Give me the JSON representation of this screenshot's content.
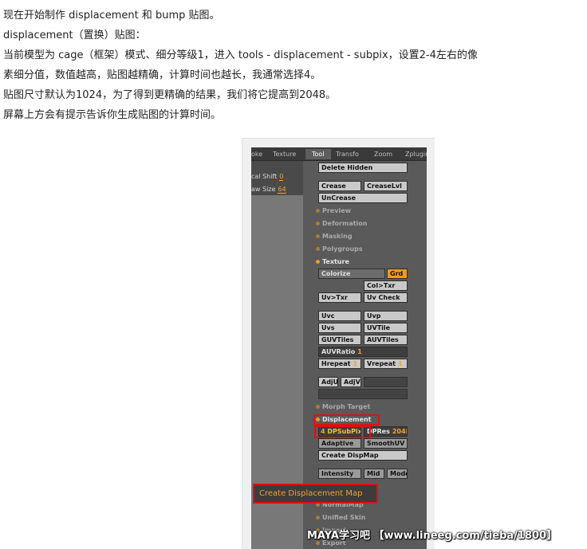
{
  "article": {
    "lines": [
      "现在开始制作 displacement 和 bump 贴图。",
      "displacement（置换）贴图：",
      "当前模型为 cage（框架）模式、细分等级1，进入 tools - displacement - subpix，设置2-4左右的像",
      "素细分值，数值越高，贴图越精确，计算时间也越长，我通常选择4。",
      "贴图尺寸默认为1024，为了得到更精确的结果，我们将它提高到2048。",
      "屏幕上方会有提示告诉你生成贴图的计算时间。"
    ]
  },
  "screenshot": {
    "menu_tabs": [
      "oke",
      "Texture",
      "Tool",
      "Transfo",
      "Zoom",
      "Zplugin"
    ],
    "left_fields": [
      {
        "label": "cal Shift",
        "value": "0"
      },
      {
        "label": "aw Size",
        "value": "64"
      }
    ],
    "buttons": {
      "delete_hidden": "Delete Hidden",
      "crease": "Crease",
      "creaselvl": "CreaseLvl",
      "uncrease": "UnCrease",
      "colorize": "Colorize",
      "grd": "Grd",
      "col_txr": "Col>Txr",
      "uv_txr": "Uv>Txr",
      "uv_check": "Uv Check",
      "uvc": "Uvc",
      "uvp": "Uvp",
      "uvs": "Uvs",
      "uvtile": "UVTile",
      "guvtiles": "GUVTiles",
      "auvtiles": "AUVTiles",
      "auvratio_label": "AUVRatio",
      "auvratio_value": "1",
      "hrepeat_label": "Hrepeat",
      "hrepeat_value": "1",
      "vrepeat_label": "Vrepeat",
      "vrepeat_value": "1",
      "adju": "AdjU",
      "adjv": "AdjV",
      "dpsubpix_value": "4",
      "dpsubpix_label": "DPSubPix",
      "dpres_label": "DPRes",
      "dpres_value": "2048",
      "adaptive": "Adaptive",
      "smoothuv": "SmoothUV",
      "create_dispmap": "Create DispMap",
      "intensity": "Intensity",
      "mid": "Mid",
      "mode": "Mode"
    },
    "sections": {
      "preview": "Preview",
      "deformation": "Deformation",
      "masking": "Masking",
      "polygroups": "Polygroups",
      "texture": "Texture",
      "morph_target": "Morph Target",
      "displacement": "Displacement",
      "normalmap": "NormalMap",
      "unified_skin": "Unified Skin",
      "import": "Import",
      "export": "Export"
    },
    "callout": "Create Displacement Map"
  },
  "watermark": "MAYA学习吧 【www.lineeg.com/tieba/1800】",
  "colors": {
    "accent_orange": "#f29a1f",
    "highlight_red": "#e01010",
    "panel_gray": "#5a5a5a"
  }
}
